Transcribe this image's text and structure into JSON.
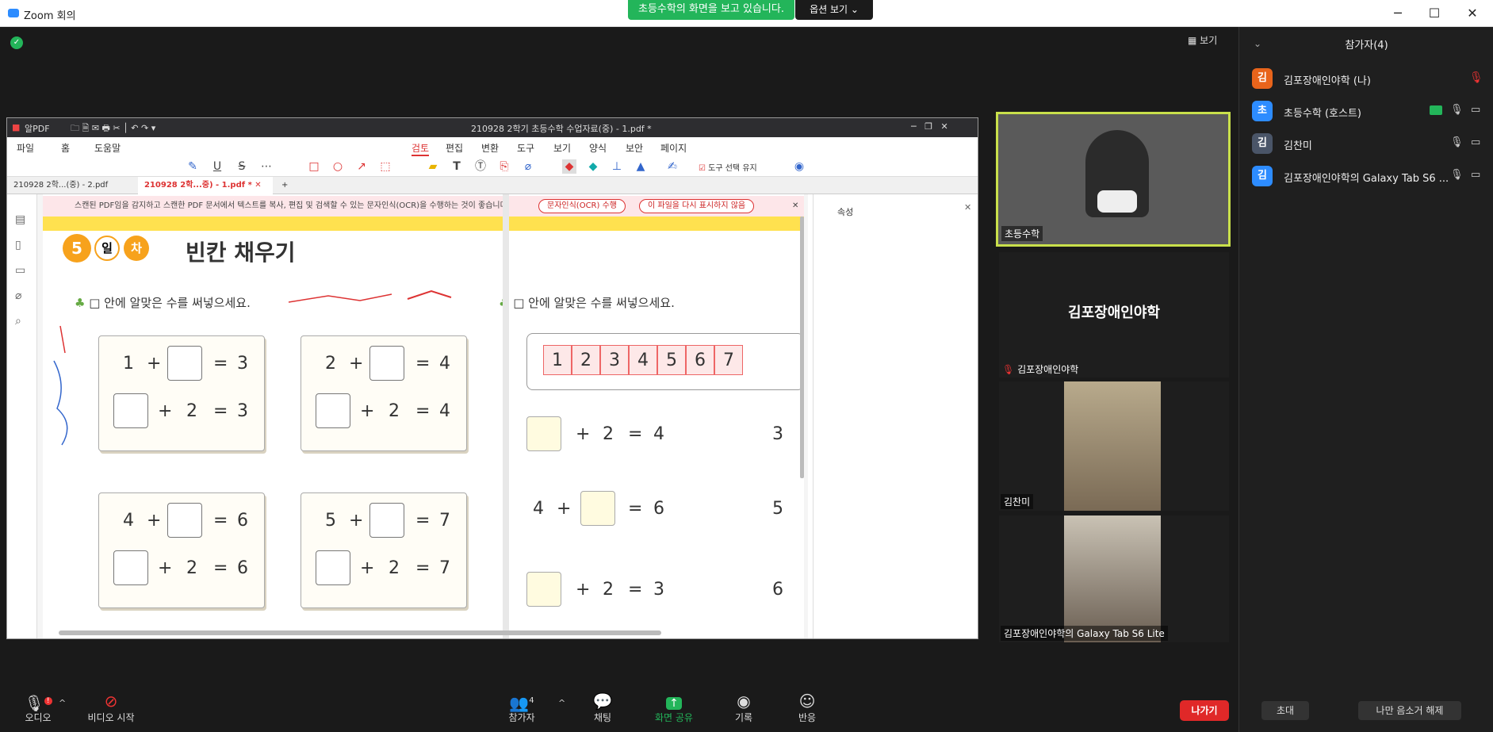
{
  "window": {
    "title": "Zoom 회의",
    "minimize": "─",
    "maximize": "☐",
    "close": "✕"
  },
  "share_banner": {
    "text": "초등수학의 화면을 보고 있습니다.",
    "view_options": "옵션 보기 ⌄"
  },
  "view_button": "보기",
  "pdf": {
    "app_name": "알PDF",
    "doc_title": "210928 2학기 초등수학 수업자료(중) - 1.pdf *",
    "menu_left": [
      "파일",
      "홈",
      "도움말"
    ],
    "menu_center": [
      "검토",
      "편집",
      "변환",
      "도구",
      "보기",
      "양식",
      "보안",
      "페이지"
    ],
    "keep_tool": "도구 선택 유지",
    "tabs": [
      "210928 2학...(중) - 2.pdf",
      "210928 2학...중) - 1.pdf *"
    ],
    "ocr_notice": "스캔된 PDF임을 감지하고 스캔한 PDF 문서에서 텍스트를 복사, 편집 및 검색할 수 있는 문자인식(OCR)을 수행하는 것이 좋습니다.",
    "ocr_button": "문자인식(OCR) 수행",
    "dont_show": "이 파일을 다시 표시하지 않음",
    "props_title": "속성",
    "badge_num": "5",
    "badge_il": "일",
    "badge_cha": "차",
    "page_title": "빈칸 채우기",
    "instruction": "□ 안에 알맞은 수를 써넣으세요.",
    "cards": [
      {
        "r1": [
          "1",
          "+",
          "=",
          "3"
        ],
        "r2": [
          "+",
          "2",
          "=",
          "3"
        ]
      },
      {
        "r1": [
          "2",
          "+",
          "=",
          "4"
        ],
        "r2": [
          "+",
          "2",
          "=",
          "4"
        ]
      },
      {
        "r1": [
          "4",
          "+",
          "=",
          "6"
        ],
        "r2": [
          "+",
          "2",
          "=",
          "6"
        ]
      },
      {
        "r1": [
          "5",
          "+",
          "=",
          "7"
        ],
        "r2": [
          "+",
          "2",
          "=",
          "7"
        ]
      }
    ],
    "number_line": [
      "1",
      "2",
      "3",
      "4",
      "5",
      "6",
      "7"
    ],
    "right_eqs": [
      [
        "+",
        "2",
        "=",
        "4"
      ],
      [
        "4",
        "+",
        "=",
        "6"
      ],
      [
        "+",
        "2",
        "=",
        "3"
      ]
    ],
    "right_cut": [
      "3",
      "5",
      "6"
    ]
  },
  "videos": {
    "main": "초등수학",
    "name_only": "김포장애인야학",
    "name_only_label": "김포장애인야학",
    "v2": "김찬미",
    "v3": "김포장애인야학의 Galaxy Tab S6 Lite"
  },
  "participants": {
    "title": "참가자(4)",
    "list": [
      {
        "initial": "김",
        "name": "김포장애인야학 (나)",
        "color": "#e8641b"
      },
      {
        "initial": "초",
        "name": "초등수학 (호스트)",
        "color": "#2d8cff"
      },
      {
        "initial": "김",
        "name": "김찬미",
        "color": "#4a5568"
      },
      {
        "initial": "김",
        "name": "김포장애인야학의 Galaxy Tab S6 ...",
        "color": "#2d8cff"
      }
    ],
    "invite": "초대",
    "unmute_me": "나만 음소거 해제"
  },
  "toolbar": {
    "audio": "오디오",
    "video": "비디오 시작",
    "participants": "참가자",
    "participants_count": "4",
    "chat": "채팅",
    "share": "화면 공유",
    "record": "기록",
    "react": "반응",
    "leave": "나가기"
  }
}
